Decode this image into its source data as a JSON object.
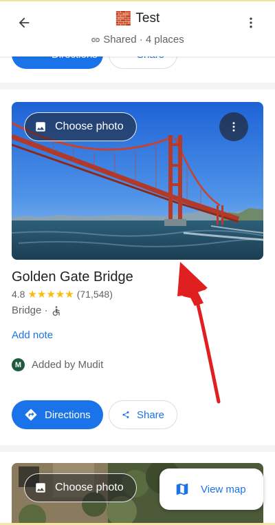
{
  "header": {
    "title_emoji": "🧱",
    "title": "Test",
    "subtitle": "Shared · 4 places"
  },
  "top_card_buttons": {
    "directions": "Directions",
    "share": "Share"
  },
  "place": {
    "choose_photo": "Choose photo",
    "name": "Golden Gate Bridge",
    "rating": "4.8",
    "stars": "★★★★★",
    "review_count": "(71,548)",
    "category": "Bridge ·",
    "add_note": "Add note",
    "avatar_initial": "M",
    "added_by": "Added by Mudit",
    "directions": "Directions",
    "share": "Share"
  },
  "next_card": {
    "choose_photo": "Choose photo"
  },
  "view_map": "View map",
  "colors": {
    "accent": "#1a73e8",
    "star": "#fbbc04",
    "arrow": "#e02020"
  }
}
